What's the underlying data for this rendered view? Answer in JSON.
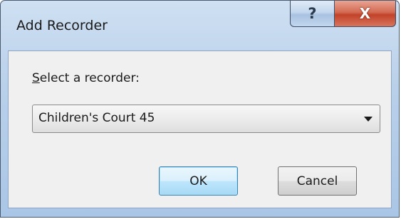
{
  "window": {
    "title": "Add Recorder",
    "help_glyph": "?",
    "close_glyph": "X"
  },
  "form": {
    "label_mnemonic": "S",
    "label_rest": "elect a recorder:",
    "selected_recorder": "Children's Court 45"
  },
  "buttons": {
    "ok_label": "OK",
    "cancel_label": "Cancel"
  },
  "icons": {
    "help": "help-icon",
    "close": "close-icon",
    "dropdown": "chevron-down-icon"
  },
  "colors": {
    "close_button": "#c2432a",
    "ok_border": "#3c7fb1",
    "title_bar": "#b9d0ea"
  }
}
